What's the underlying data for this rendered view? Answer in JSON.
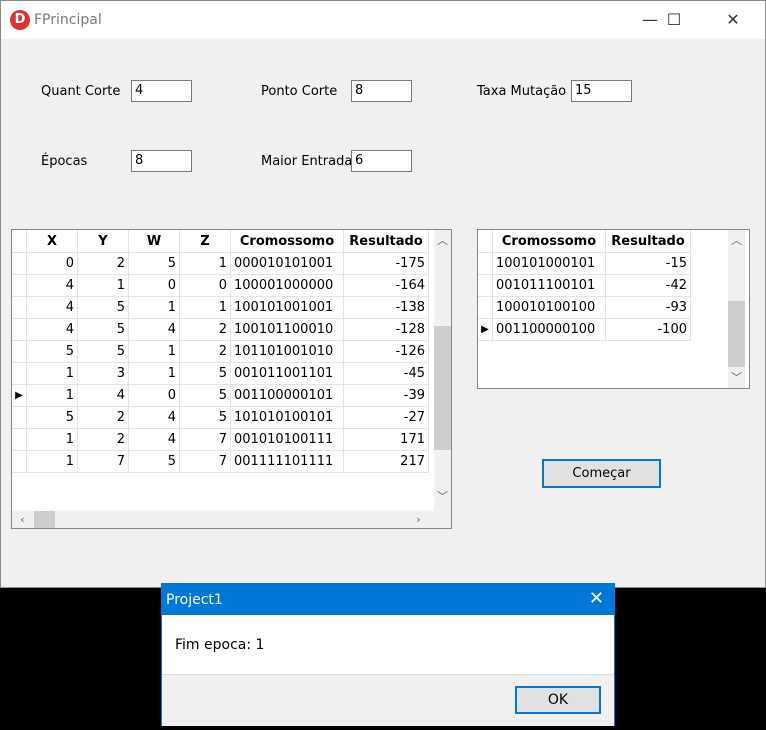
{
  "window": {
    "title": "FPrincipal",
    "app_icon_letter": "D",
    "minimize_glyph": "—",
    "maximize_glyph": "☐",
    "close_glyph": "✕"
  },
  "form": {
    "quant_corte": {
      "label": "Quant Corte",
      "value": "4"
    },
    "ponto_corte": {
      "label": "Ponto Corte",
      "value": "8"
    },
    "taxa_mutacao": {
      "label": "Taxa Mutação",
      "value": "15"
    },
    "epocas": {
      "label": "Épocas",
      "value": "8"
    },
    "maior_entrada": {
      "label": "Maior Entrada",
      "value": "6"
    }
  },
  "main_grid": {
    "columns": [
      "X",
      "Y",
      "W",
      "Z",
      "Cromossomo",
      "Resultado"
    ],
    "rows": [
      [
        "0",
        "2",
        "5",
        "1",
        "000010101001",
        "-175"
      ],
      [
        "4",
        "1",
        "0",
        "0",
        "100001000000",
        "-164"
      ],
      [
        "4",
        "5",
        "1",
        "1",
        "100101001001",
        "-138"
      ],
      [
        "4",
        "5",
        "4",
        "2",
        "100101100010",
        "-128"
      ],
      [
        "5",
        "5",
        "1",
        "2",
        "101101001010",
        "-126"
      ],
      [
        "1",
        "3",
        "1",
        "5",
        "001011001101",
        "-45"
      ],
      [
        "1",
        "4",
        "0",
        "5",
        "001100000101",
        "-39"
      ],
      [
        "5",
        "2",
        "4",
        "5",
        "101010100101",
        "-27"
      ],
      [
        "1",
        "2",
        "4",
        "7",
        "001010100111",
        "171"
      ],
      [
        "1",
        "7",
        "5",
        "7",
        "001111101111",
        "217"
      ]
    ],
    "current_row_index": 6
  },
  "best_grid": {
    "columns": [
      "Cromossomo",
      "Resultado"
    ],
    "rows": [
      [
        "100101000101",
        "-15"
      ],
      [
        "001011100101",
        "-42"
      ],
      [
        "100010100100",
        "-93"
      ],
      [
        "001100000100",
        "-100"
      ]
    ],
    "current_row_index": 3
  },
  "start_button": {
    "label": "Começar"
  },
  "dialog": {
    "title": "Project1",
    "message": "Fim epoca: 1",
    "ok_label": "OK",
    "close_glyph": "✕"
  },
  "icons": {
    "row_indicator": "▶",
    "scroll_up": "︿",
    "scroll_down": "﹀",
    "scroll_left": "‹",
    "scroll_right": "›"
  },
  "colors": {
    "accent": "#0078d7",
    "app_icon": "#e0312f",
    "window_bg": "#f0f0f0"
  }
}
